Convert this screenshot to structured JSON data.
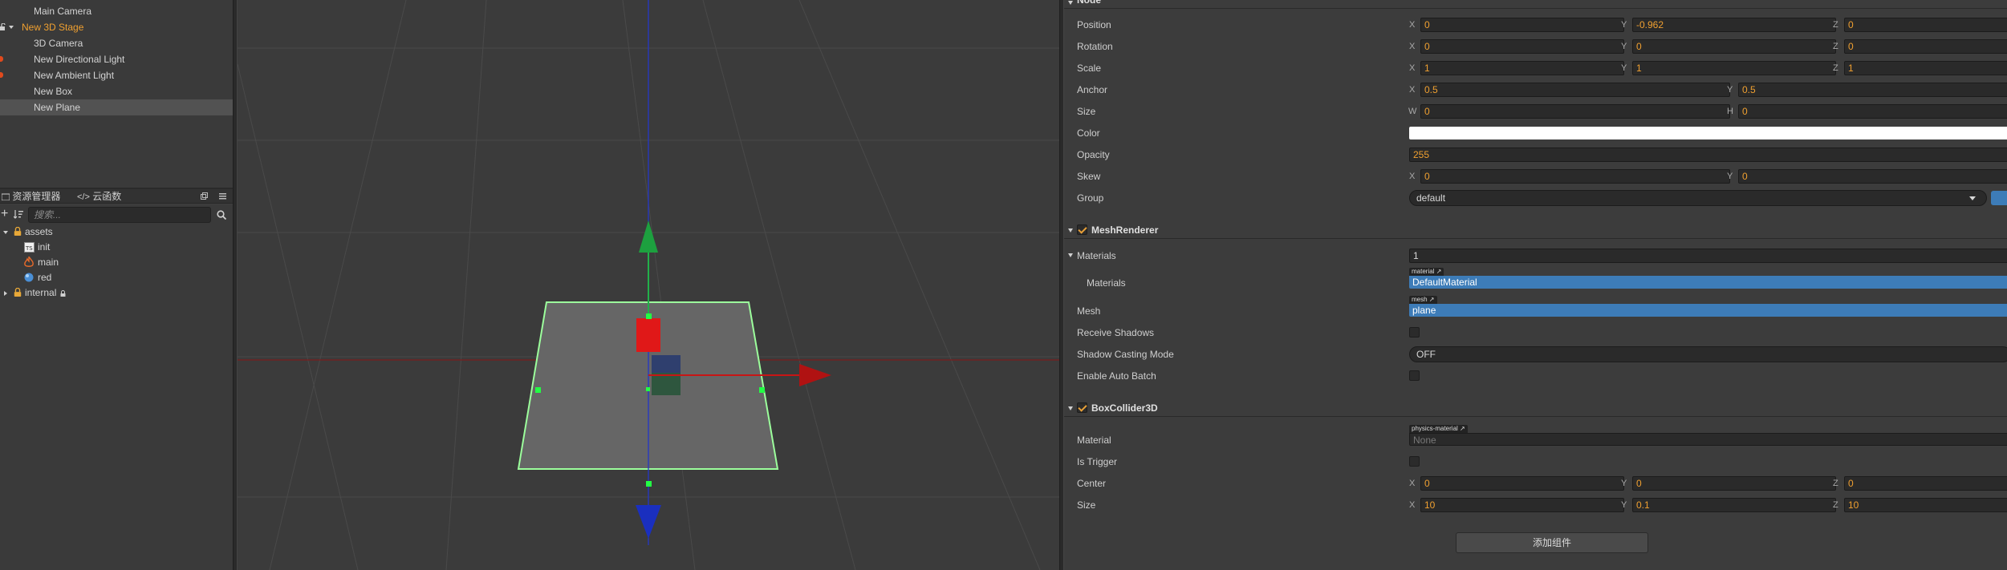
{
  "hierarchy": {
    "items": [
      {
        "label": "Main Camera"
      },
      {
        "label": "New 3D Stage"
      },
      {
        "label": "3D Camera"
      },
      {
        "label": "New Directional Light"
      },
      {
        "label": "New Ambient Light"
      },
      {
        "label": "New Box"
      },
      {
        "label": "New Plane"
      }
    ]
  },
  "assets_panel": {
    "tabs": [
      {
        "label": "资源管理器"
      },
      {
        "label": "云函数"
      }
    ],
    "search_placeholder": "搜索...",
    "tree": [
      {
        "label": "assets"
      },
      {
        "label": "init",
        "icon": "ts-file-icon"
      },
      {
        "label": "main",
        "icon": "fire-icon"
      },
      {
        "label": "red",
        "icon": "material-ball-icon"
      },
      {
        "label": "internal"
      }
    ]
  },
  "inspector": {
    "node_section": {
      "title": "Node"
    },
    "position": {
      "label": "Position",
      "x_axis": "X",
      "x": "0",
      "y_axis": "Y",
      "y": "-0.962",
      "z_axis": "Z",
      "z": "0"
    },
    "rotation": {
      "label": "Rotation",
      "x_axis": "X",
      "x": "0",
      "y_axis": "Y",
      "y": "0",
      "z_axis": "Z",
      "z": "0"
    },
    "scale": {
      "label": "Scale",
      "x_axis": "X",
      "x": "1",
      "y_axis": "Y",
      "y": "1",
      "z_axis": "Z",
      "z": "1"
    },
    "anchor": {
      "label": "Anchor",
      "x_axis": "X",
      "x": "0.5",
      "y_axis": "Y",
      "y": "0.5"
    },
    "size": {
      "label": "Size",
      "w_axis": "W",
      "w": "0",
      "h_axis": "H",
      "h": "0"
    },
    "color": {
      "label": "Color",
      "value": "#ffffff"
    },
    "opacity": {
      "label": "Opacity",
      "value": "255"
    },
    "skew": {
      "label": "Skew",
      "x_axis": "X",
      "x": "0",
      "y_axis": "Y",
      "y": "0"
    },
    "group": {
      "label": "Group",
      "value": "default"
    },
    "mesh_renderer": {
      "title": "MeshRenderer",
      "materials_label": "Materials",
      "materials_count": "1",
      "materials_sub_label": "Materials",
      "material_tag": "material",
      "material_value": "DefaultMaterial",
      "mesh_label": "Mesh",
      "mesh_tag": "mesh",
      "mesh_value": "plane",
      "receive_shadows_label": "Receive Shadows",
      "shadow_casting_label": "Shadow Casting Mode",
      "shadow_casting_value": "OFF",
      "auto_batch_label": "Enable Auto Batch"
    },
    "box_collider": {
      "title": "BoxCollider3D",
      "material_label": "Material",
      "material_tag": "physics-material",
      "material_value": "None",
      "is_trigger_label": "Is Trigger",
      "center": {
        "label": "Center",
        "x_axis": "X",
        "x": "0",
        "y_axis": "Y",
        "y": "0",
        "z_axis": "Z",
        "z": "0"
      },
      "size": {
        "label": "Size",
        "x_axis": "X",
        "x": "10",
        "y_axis": "Y",
        "y": "0.1",
        "z_axis": "Z",
        "z": "10"
      }
    },
    "add_component_label": "添加组件"
  },
  "colors": {
    "accent_orange": "#f0a030",
    "selection_blue": "#3d7cb8",
    "gizmo_green": "#22b04a",
    "gizmo_red": "#c81515",
    "gizmo_blue": "#1a2fbf"
  }
}
